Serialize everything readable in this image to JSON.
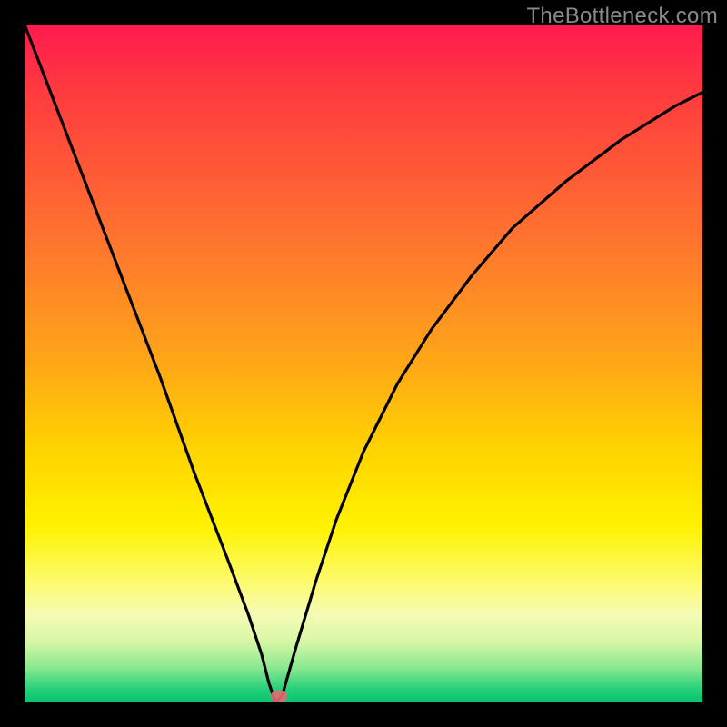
{
  "watermark": "TheBottleneck.com",
  "marker": {
    "x_pct": 37.5,
    "y_pct": 99.0
  },
  "chart_data": {
    "type": "line",
    "title": "",
    "xlabel": "",
    "ylabel": "",
    "xlim": [
      0,
      100
    ],
    "ylim": [
      0,
      100
    ],
    "grid": false,
    "legend": false,
    "annotations": [
      "TheBottleneck.com"
    ],
    "background": "rainbow-vertical-gradient (red top → green bottom)",
    "series": [
      {
        "name": "bottleneck-curve",
        "description": "V-shaped curve; steep near-linear left branch descending to a minimum around x≈37, then a concave right branch rising toward the top-right.",
        "x": [
          0,
          5,
          10,
          15,
          20,
          25,
          30,
          33,
          35,
          36,
          37,
          38,
          40,
          43,
          46,
          50,
          55,
          60,
          66,
          72,
          80,
          88,
          96,
          100
        ],
        "y": [
          100,
          87,
          74,
          61,
          48,
          34,
          21,
          13,
          7,
          3,
          0,
          1,
          8,
          18,
          27,
          37,
          47,
          55,
          63,
          70,
          77,
          83,
          88,
          90
        ]
      }
    ],
    "marker": {
      "x": 37.5,
      "y": 0,
      "color": "#e46a74",
      "shape": "pill"
    }
  }
}
